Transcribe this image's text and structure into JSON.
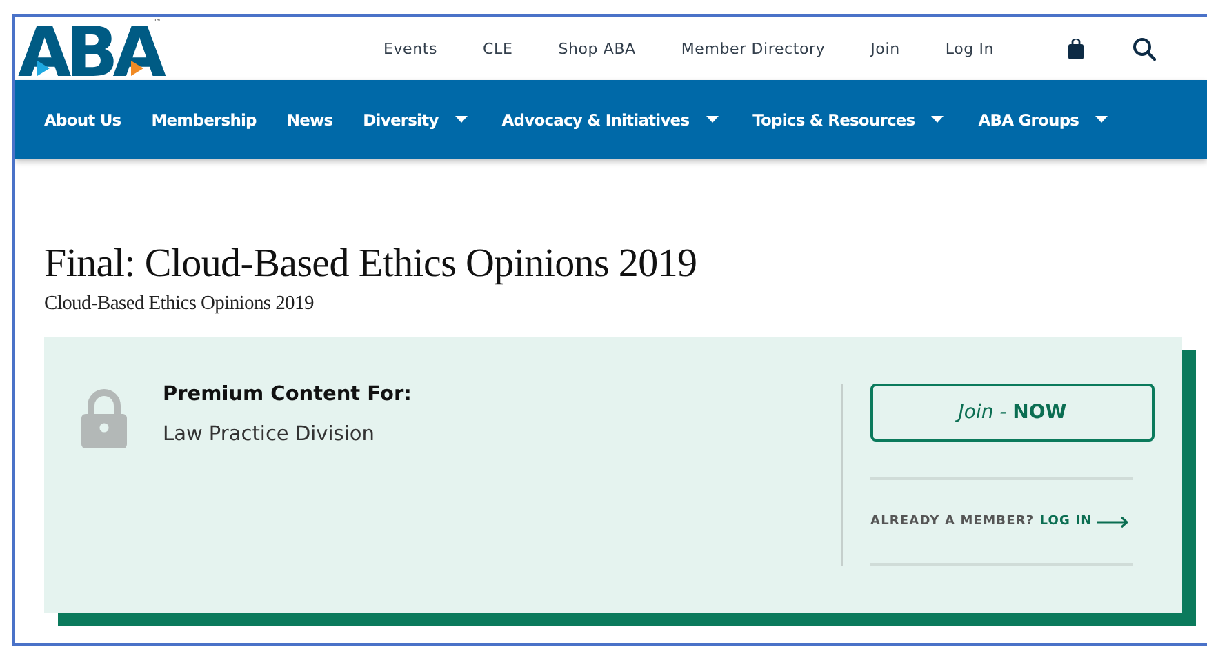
{
  "header": {
    "logo": {
      "text": "ABA",
      "trademark": "™"
    },
    "utility_links": [
      "Events",
      "CLE",
      "Shop ABA",
      "Member Directory",
      "Join",
      "Log In"
    ]
  },
  "nav": [
    {
      "label": "About Us",
      "dropdown": false
    },
    {
      "label": "Membership",
      "dropdown": false
    },
    {
      "label": "News",
      "dropdown": false
    },
    {
      "label": "Diversity",
      "dropdown": true
    },
    {
      "label": "Advocacy & Initiatives",
      "dropdown": true
    },
    {
      "label": "Topics & Resources",
      "dropdown": true
    },
    {
      "label": "ABA Groups",
      "dropdown": true
    }
  ],
  "page": {
    "title": "Final: Cloud-Based Ethics Opinions 2019",
    "subtitle": "Cloud-Based Ethics Opinions 2019"
  },
  "premium": {
    "heading": "Premium Content For:",
    "audience": "Law Practice Division",
    "join_button": "*Join -* **NOW**",
    "member_prompt": "ALREADY A MEMBER?",
    "login_link": "LOG IN"
  }
}
